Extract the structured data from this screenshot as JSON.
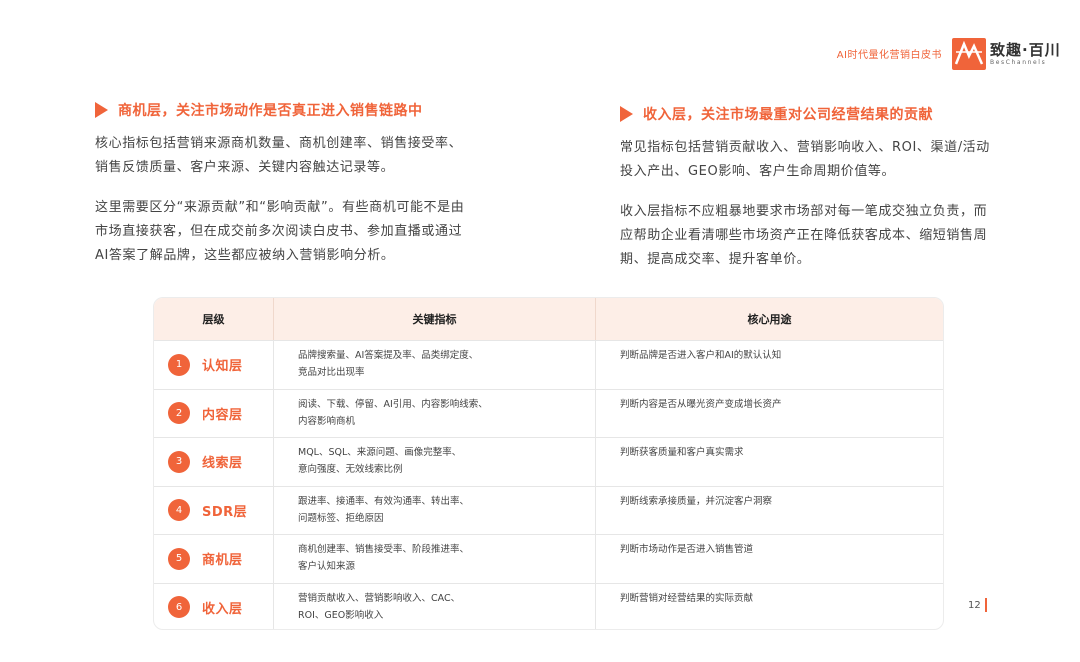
{
  "header": {
    "doc_title": "AI时代量化营销白皮书",
    "logo_cn": "致趣·百川",
    "logo_en": "BesChannels"
  },
  "left_section": {
    "title": "商机层，关注市场动作是否真正进入销售链路中",
    "para1": "核心指标包括营销来源商机数量、商机创建率、销售接受率、销售反馈质量、客户来源、关键内容触达记录等。",
    "para2": "这里需要区分“来源贡献”和“影响贡献”。有些商机可能不是由市场直接获客，但在成交前多次阅读白皮书、参加直播或通过AI答案了解品牌，这些都应被纳入营销影响分析。"
  },
  "right_section": {
    "title": "收入层，关注市场最重对公司经营结果的贡献",
    "para1": "常见指标包括营销贡献收入、营销影响收入、ROI、渠道/活动投入产出、GEO影响、客户生命周期价值等。",
    "para2": "收入层指标不应粗暴地要求市场部对每一笔成交独立负责，而应帮助企业看清哪些市场资产正在降低获客成本、缩短销售周期、提高成交率、提升客单价。"
  },
  "table": {
    "headers": [
      "层级",
      "关键指标",
      "核心用途"
    ],
    "rows": [
      {
        "num": "1",
        "level": "认知层",
        "metrics": [
          "品牌搜索量、AI答案提及率、品类绑定度、",
          "竞品对比出现率"
        ],
        "use": "判断品牌是否进入客户和AI的默认认知"
      },
      {
        "num": "2",
        "level": "内容层",
        "metrics": [
          "阅读、下载、停留、AI引用、内容影响线索、",
          "内容影响商机"
        ],
        "use": "判断内容是否从曝光资产变成增长资产"
      },
      {
        "num": "3",
        "level": "线索层",
        "metrics": [
          "MQL、SQL、来源问题、画像完整率、",
          "意向强度、无效线索比例"
        ],
        "use": "判断获客质量和客户真实需求"
      },
      {
        "num": "4",
        "level": "SDR层",
        "metrics": [
          "跟进率、接通率、有效沟通率、转出率、",
          "问题标签、拒绝原因"
        ],
        "use": "判断线索承接质量，并沉淀客户洞察"
      },
      {
        "num": "5",
        "level": "商机层",
        "metrics": [
          "商机创建率、销售接受率、阶段推进率、",
          "客户认知来源"
        ],
        "use": "判断市场动作是否进入销售管道"
      },
      {
        "num": "6",
        "level": "收入层",
        "metrics": [
          "营销贡献收入、营销影响收入、CAC、",
          "ROI、GEO影响收入"
        ],
        "use": "判断营销对经营结果的实际贡献"
      }
    ]
  },
  "page_number": "12",
  "colors": {
    "accent": "#f0643a",
    "header_bg": "#fdeee7"
  }
}
